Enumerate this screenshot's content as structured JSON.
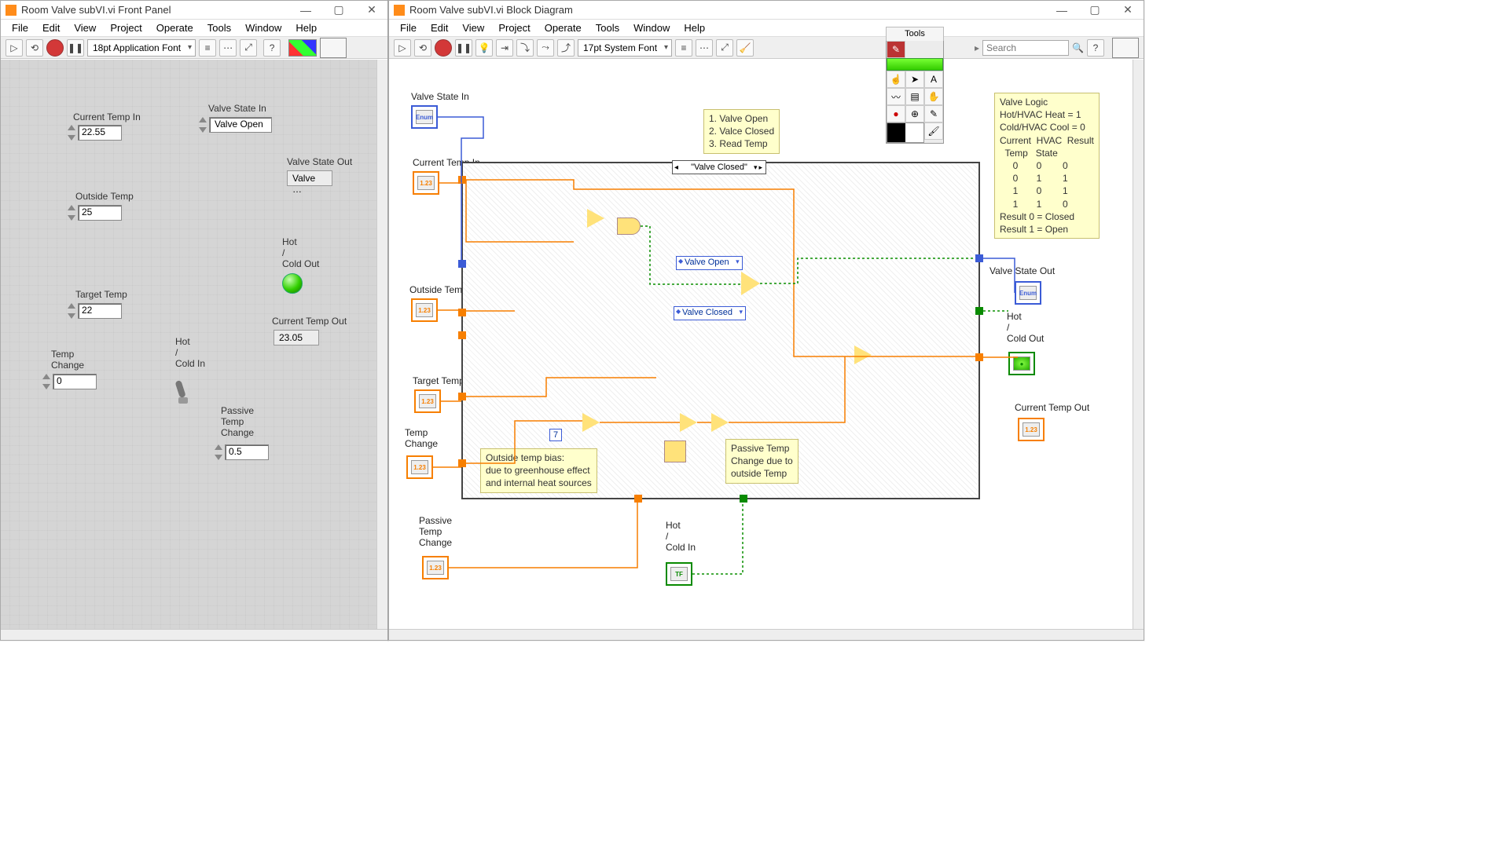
{
  "front_panel": {
    "title": "Room Valve subVI.vi Front Panel",
    "menus": [
      "File",
      "Edit",
      "View",
      "Project",
      "Operate",
      "Tools",
      "Window",
      "Help"
    ],
    "font": "18pt Application Font",
    "controls": {
      "current_temp_in": {
        "label": "Current Temp In",
        "value": "22.55"
      },
      "outside_temp": {
        "label": "Outside Temp",
        "value": "25"
      },
      "target_temp": {
        "label": "Target Temp",
        "value": "22"
      },
      "temp_change": {
        "label": "Temp\nChange",
        "value": "0"
      },
      "valve_state_in": {
        "label": "Valve State In",
        "value": "Valve Open"
      },
      "hot_cold_in": {
        "label": "Hot\n/\nCold In"
      },
      "passive_temp_change": {
        "label": "Passive\nTemp\nChange",
        "value": "0.5"
      }
    },
    "indicators": {
      "valve_state_out": {
        "label": "Valve State Out",
        "value": "Valve …"
      },
      "current_temp_out": {
        "label": "Current Temp Out",
        "value": "23.05"
      },
      "hot_cold_out": {
        "label": "Hot\n/\nCold Out"
      }
    }
  },
  "block_diagram": {
    "title": "Room Valve subVI.vi Block Diagram",
    "menus": [
      "File",
      "Edit",
      "View",
      "Project",
      "Operate",
      "Tools",
      "Window",
      "Help"
    ],
    "font": "17pt System Font",
    "search_placeholder": "Search",
    "case_selector": "\"Valve Closed\"",
    "terminals": {
      "valve_state_in": "Valve State In",
      "current_temp_in": "Current Temp In",
      "outside_temp": "Outside Temp",
      "target_temp": "Target Temp",
      "temp_change": "Temp\nChange",
      "passive_temp_change": "Passive\nTemp\nChange",
      "hot_cold_in": "Hot\n/\nCold In",
      "valve_state_out": "Valve State Out",
      "hot_cold_out": "Hot\n/\nCold Out",
      "current_temp_out": "Current Temp Out"
    },
    "enum_consts": {
      "open": "Valve Open",
      "closed": "Valve Closed"
    },
    "num_const_7": "7",
    "comments": {
      "step_list": "1. Valve Open\n2. Valce Closed\n3. Read Temp",
      "bias": "Outside temp bias:\ndue to greenhouse effect\nand internal heat sources",
      "passive": "Passive Temp\nChange due to\noutside Temp",
      "logic": "Valve Logic\nHot/HVAC Heat = 1\nCold/HVAC Cool = 0\nCurrent  HVAC  Result\n  Temp   State\n     0       0        0\n     0       1        1\n     1       0        1\n     1       1        0\nResult 0 = Closed\nResult 1 = Open"
    },
    "tools_title": "Tools"
  }
}
